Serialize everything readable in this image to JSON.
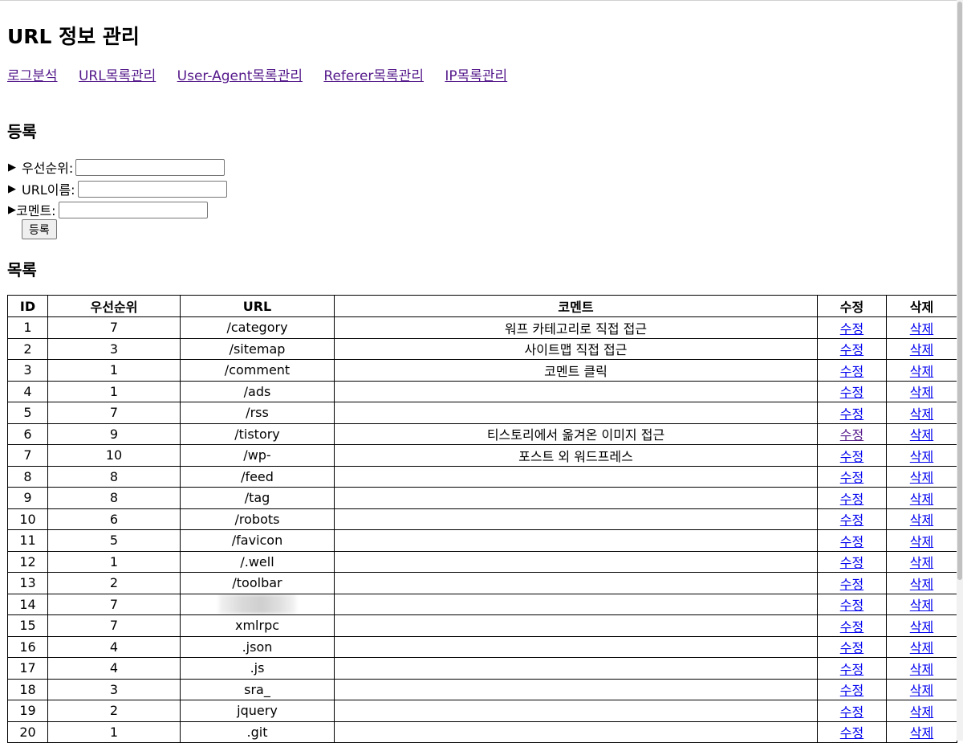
{
  "page": {
    "title": "URL 정보 관리"
  },
  "nav": [
    {
      "label": "로그분석"
    },
    {
      "label": "URL목록관리"
    },
    {
      "label": "User-Agent목록관리"
    },
    {
      "label": "Referer목록관리"
    },
    {
      "label": "IP목록관리"
    }
  ],
  "register": {
    "title": "등록",
    "priority_label": "우선순위:",
    "url_label": "URL이름:",
    "comment_label": "코멘트:",
    "priority_value": "",
    "url_value": "",
    "comment_value": "",
    "submit_label": "등록"
  },
  "list": {
    "title": "목록",
    "headers": {
      "id": "ID",
      "priority": "우선순위",
      "url": "URL",
      "comment": "코멘트",
      "edit": "수정",
      "delete": "삭제"
    },
    "edit_link": "수정",
    "delete_link": "삭제",
    "rows": [
      {
        "id": "1",
        "priority": "7",
        "url": "/category",
        "comment": "워프 카테고리로 직접 접근"
      },
      {
        "id": "2",
        "priority": "3",
        "url": "/sitemap",
        "comment": "사이트맵 직접 접근"
      },
      {
        "id": "3",
        "priority": "1",
        "url": "/comment",
        "comment": "코멘트 클릭"
      },
      {
        "id": "4",
        "priority": "1",
        "url": "/ads",
        "comment": ""
      },
      {
        "id": "5",
        "priority": "7",
        "url": "/rss",
        "comment": ""
      },
      {
        "id": "6",
        "priority": "9",
        "url": "/tistory",
        "comment": "티스토리에서 옮겨온 이미지 접근"
      },
      {
        "id": "7",
        "priority": "10",
        "url": "/wp-",
        "comment": "포스트 외 워드프레스"
      },
      {
        "id": "8",
        "priority": "8",
        "url": "/feed",
        "comment": ""
      },
      {
        "id": "9",
        "priority": "8",
        "url": "/tag",
        "comment": ""
      },
      {
        "id": "10",
        "priority": "6",
        "url": "/robots",
        "comment": ""
      },
      {
        "id": "11",
        "priority": "5",
        "url": "/favicon",
        "comment": ""
      },
      {
        "id": "12",
        "priority": "1",
        "url": "/.well",
        "comment": ""
      },
      {
        "id": "13",
        "priority": "2",
        "url": "/toolbar",
        "comment": ""
      },
      {
        "id": "14",
        "priority": "7",
        "url": "",
        "comment": ""
      },
      {
        "id": "15",
        "priority": "7",
        "url": "xmlrpc",
        "comment": ""
      },
      {
        "id": "16",
        "priority": "4",
        "url": ".json",
        "comment": ""
      },
      {
        "id": "17",
        "priority": "4",
        "url": ".js",
        "comment": ""
      },
      {
        "id": "18",
        "priority": "3",
        "url": "sra_",
        "comment": ""
      },
      {
        "id": "19",
        "priority": "2",
        "url": "jquery",
        "comment": ""
      },
      {
        "id": "20",
        "priority": "1",
        "url": ".git",
        "comment": ""
      }
    ]
  }
}
